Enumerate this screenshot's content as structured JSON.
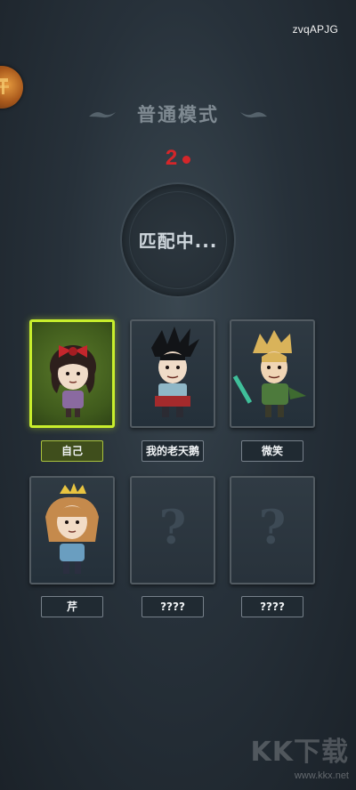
{
  "header": {
    "user_code": "zvqAPJG"
  },
  "mode": {
    "title": "普通模式",
    "players_count": "2"
  },
  "matching": {
    "status_text": "匹配中..."
  },
  "players": [
    {
      "name": "自己",
      "character": "girl-with-red-bow",
      "is_self": true,
      "filled": true
    },
    {
      "name": "我的老天鹅",
      "character": "spiky-haired-gentleman",
      "is_self": false,
      "filled": true
    },
    {
      "name": "微笑",
      "character": "blond-elf-with-sword",
      "is_self": false,
      "filled": true
    },
    {
      "name": "芹",
      "character": "girl-with-crown",
      "is_self": false,
      "filled": true
    },
    {
      "name": "????",
      "character": "unknown",
      "is_self": false,
      "filled": false
    },
    {
      "name": "????",
      "character": "unknown",
      "is_self": false,
      "filled": false
    }
  ],
  "watermark": {
    "logo": "KK下载",
    "url": "www.kkx.net"
  },
  "colors": {
    "self_highlight": "#c8ee2c",
    "count_red": "#d4262a",
    "background": "#27313a"
  }
}
